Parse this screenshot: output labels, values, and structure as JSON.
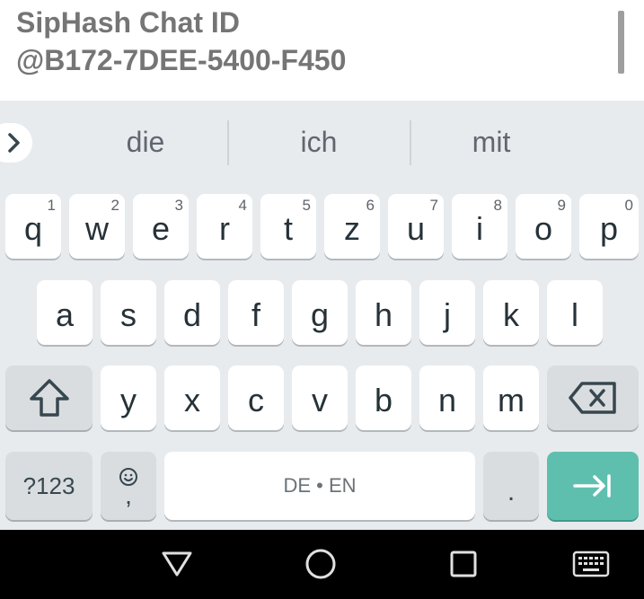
{
  "header": {
    "title": "SipHash Chat ID",
    "id": "@B172-7DEE-5400-F450"
  },
  "suggestions": [
    "die",
    "ich",
    "mit"
  ],
  "keys": {
    "row1": [
      {
        "letter": "q",
        "hint": "1"
      },
      {
        "letter": "w",
        "hint": "2"
      },
      {
        "letter": "e",
        "hint": "3"
      },
      {
        "letter": "r",
        "hint": "4"
      },
      {
        "letter": "t",
        "hint": "5"
      },
      {
        "letter": "z",
        "hint": "6"
      },
      {
        "letter": "u",
        "hint": "7"
      },
      {
        "letter": "i",
        "hint": "8"
      },
      {
        "letter": "o",
        "hint": "9"
      },
      {
        "letter": "p",
        "hint": "0"
      }
    ],
    "row2": [
      "a",
      "s",
      "d",
      "f",
      "g",
      "h",
      "j",
      "k",
      "l"
    ],
    "row3": [
      "y",
      "x",
      "c",
      "v",
      "b",
      "n",
      "m"
    ],
    "symbols_label": "?123",
    "comma_label": ",",
    "space_label": "DE • EN",
    "period_label": "."
  },
  "colors": {
    "accent": "#5fbfae",
    "key_bg": "#ffffff",
    "keyboard_bg": "#e8ebee",
    "function_key_bg": "#dadde0",
    "header_text": "#757575"
  },
  "icons": {
    "expand": "chevron-right-icon",
    "shift": "shift-icon",
    "backspace": "backspace-icon",
    "emoji": "emoji-icon",
    "enter": "next-tab-icon",
    "nav_back": "back-triangle-icon",
    "nav_home": "home-circle-icon",
    "nav_recent": "recents-square-icon",
    "nav_keyboard": "keyboard-icon"
  }
}
